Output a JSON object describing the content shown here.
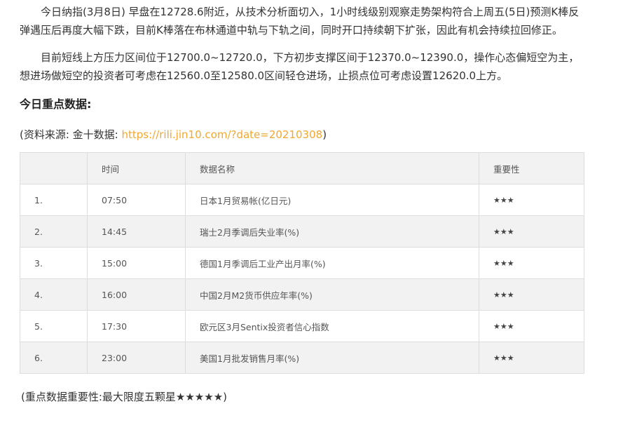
{
  "paragraphs": [
    "今日纳指(3月8日) 早盘在12728.6附近，从技术分析面切入，1小时线级别观察走势架构符合上周五(5日)预测K棒反弹遇压后再度大幅下跌，目前K棒落在布林通道中轨与下轨之间，同时开口持续朝下扩张，因此有机会持续拉回修正。",
    "目前短线上方压力区间位于12700.0~12720.0，下方初步支撑区间于12370.0~12390.0，操作心态偏短空为主，想进场做短空的投资者可考虑在12560.0至12580.0区间轻仓进场，止损点位可考虑设置12620.0上方。"
  ],
  "heading": "今日重点数据:",
  "source": {
    "prefix": "(资料来源: 金十数据: ",
    "link": "https://rili.jin10.com/?date=20210308",
    "suffix": ")"
  },
  "table": {
    "headers": [
      "",
      "时间",
      "数据名称",
      "重要性"
    ],
    "rows": [
      [
        "1.",
        "07:50",
        "日本1月贸易帐(亿日元)",
        "★★★"
      ],
      [
        "2.",
        "14:45",
        "瑞士2月季调后失业率(%)",
        "★★★"
      ],
      [
        "3.",
        "15:00",
        "德国1月季调后工业产出月率(%)",
        "★★★"
      ],
      [
        "4.",
        "16:00",
        "中国2月M2货币供应年率(%)",
        "★★★"
      ],
      [
        "5.",
        "17:30",
        "欧元区3月Sentix投资者信心指数",
        "★★★"
      ],
      [
        "6.",
        "23:00",
        "美国1月批发销售月率(%)",
        "★★★"
      ]
    ]
  },
  "note": "(重点数据重要性:最大限度五颗星★★★★★)",
  "colors": {
    "link": "#f0a830",
    "stripe": "#f2f2f2",
    "border": "#dddddd"
  }
}
